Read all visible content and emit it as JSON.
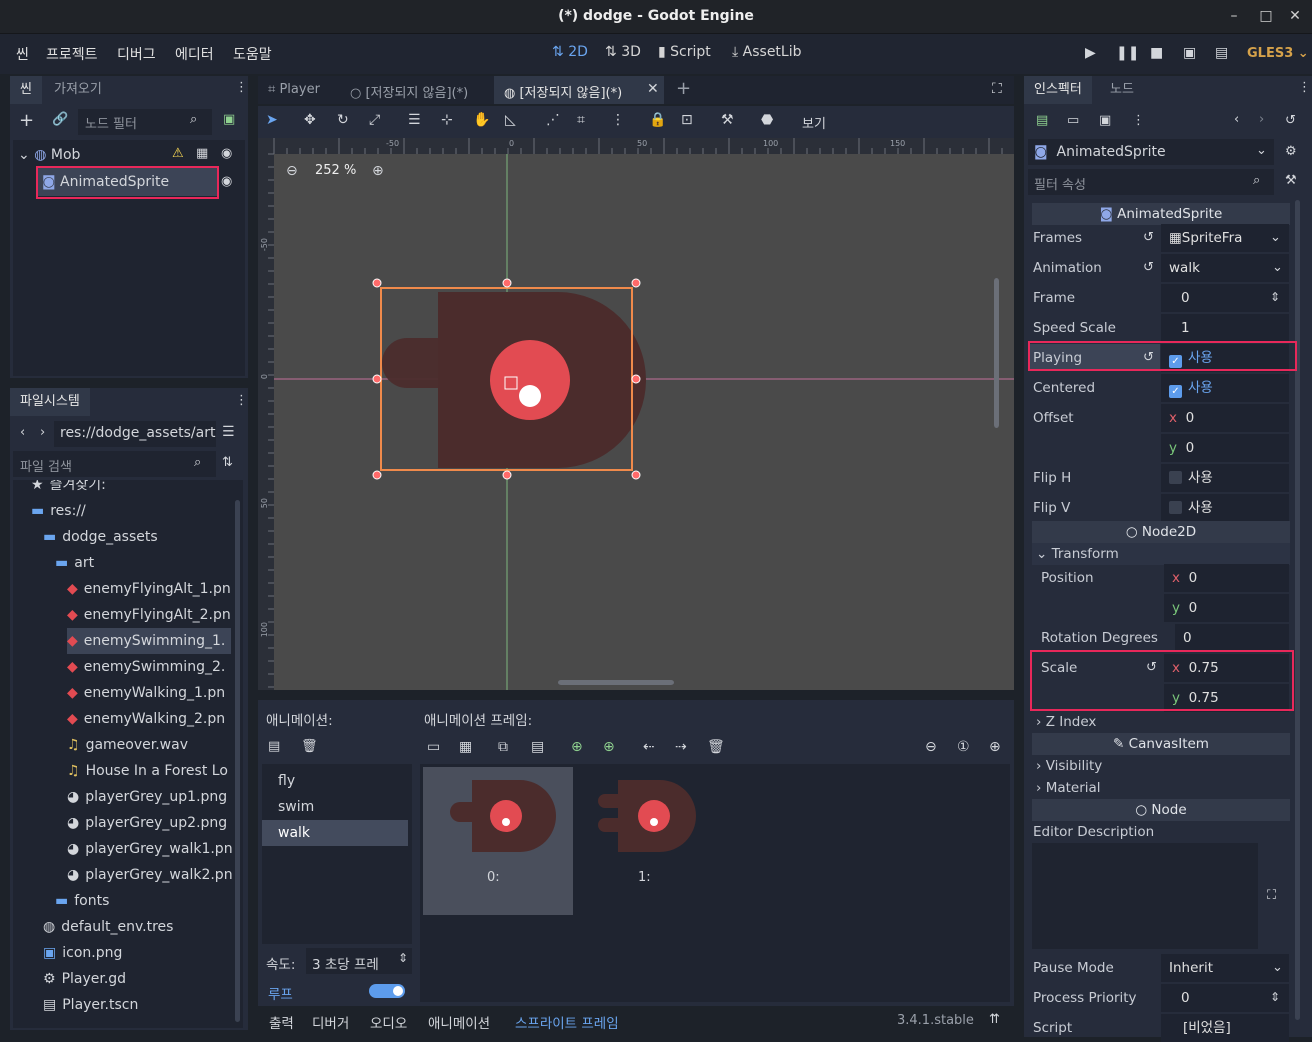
{
  "window": {
    "title": "(*) dodge - Godot Engine",
    "minimize": "–",
    "maximize": "□",
    "close": "✕"
  },
  "menu": {
    "items": [
      "씬",
      "프로젝트",
      "디버그",
      "에디터",
      "도움말"
    ]
  },
  "modes": {
    "m2d": "2D",
    "m3d": "3D",
    "script": "Script",
    "assetlib": "AssetLib",
    "renderer": "GLES3"
  },
  "scene_dock": {
    "tabs": [
      "씬",
      "가져오기"
    ],
    "filter_placeholder": "노드 필터",
    "nodes": [
      {
        "name": "Mob"
      },
      {
        "name": "AnimatedSprite"
      }
    ]
  },
  "fs_dock": {
    "title": "파일시스템",
    "path": "res://dodge_assets/art",
    "search_placeholder": "파일 검색",
    "items": [
      {
        "label": "즐겨찾기:",
        "indent": 0,
        "kind": "star"
      },
      {
        "label": "res://",
        "indent": 0,
        "kind": "folder"
      },
      {
        "label": "dodge_assets",
        "indent": 1,
        "kind": "folder"
      },
      {
        "label": "art",
        "indent": 2,
        "kind": "folder"
      },
      {
        "label": "enemyFlyingAlt_1.pn",
        "indent": 3,
        "kind": "img"
      },
      {
        "label": "enemyFlyingAlt_2.pn",
        "indent": 3,
        "kind": "img"
      },
      {
        "label": "enemySwimming_1.",
        "indent": 3,
        "kind": "img",
        "selected": true
      },
      {
        "label": "enemySwimming_2.",
        "indent": 3,
        "kind": "img"
      },
      {
        "label": "enemyWalking_1.pn",
        "indent": 3,
        "kind": "img"
      },
      {
        "label": "enemyWalking_2.pn",
        "indent": 3,
        "kind": "img"
      },
      {
        "label": "gameover.wav",
        "indent": 3,
        "kind": "audio"
      },
      {
        "label": "House In a Forest Lo",
        "indent": 3,
        "kind": "audio"
      },
      {
        "label": "playerGrey_up1.png",
        "indent": 3,
        "kind": "player"
      },
      {
        "label": "playerGrey_up2.png",
        "indent": 3,
        "kind": "player"
      },
      {
        "label": "playerGrey_walk1.pn",
        "indent": 3,
        "kind": "player"
      },
      {
        "label": "playerGrey_walk2.pn",
        "indent": 3,
        "kind": "player"
      },
      {
        "label": "fonts",
        "indent": 2,
        "kind": "folder"
      },
      {
        "label": "default_env.tres",
        "indent": 1,
        "kind": "globe"
      },
      {
        "label": "icon.png",
        "indent": 1,
        "kind": "icon"
      },
      {
        "label": "Player.gd",
        "indent": 1,
        "kind": "gear"
      },
      {
        "label": "Player.tscn",
        "indent": 1,
        "kind": "clap"
      }
    ]
  },
  "editor_tabs": [
    {
      "label": "Player"
    },
    {
      "label": "[저장되지 않음](*)"
    },
    {
      "label": "[저장되지 않음](*)"
    }
  ],
  "toolbar": {
    "view_label": "보기"
  },
  "viewport": {
    "zoom": "252 %",
    "ruler_top": [
      "-50",
      "0",
      "50",
      "100",
      "150"
    ],
    "ruler_left": [
      "-50",
      "0",
      "50",
      "100"
    ]
  },
  "anim_panel": {
    "animations_title": "애니메이션:",
    "frames_title": "애니메이션 프레임:",
    "animations": [
      "fly",
      "swim",
      "walk"
    ],
    "selected_animation": "walk",
    "frames": [
      "0:",
      "1:"
    ],
    "speed_label": "속도:",
    "speed_value": "3 초당 프레",
    "loop_label": "루프",
    "loop_on": true
  },
  "bottom_tabs": [
    "출력",
    "디버거",
    "오디오",
    "애니메이션",
    "스프라이트 프레임"
  ],
  "version": "3.4.1.stable",
  "inspector": {
    "tabs": [
      "인스펙터",
      "노드"
    ],
    "object": "AnimatedSprite",
    "filter_placeholder": "필터 속성",
    "section_animated": "AnimatedSprite",
    "frames_label": "Frames",
    "frames_value": "SpriteFra",
    "animation_label": "Animation",
    "animation_value": "walk",
    "frame_label": "Frame",
    "frame_value": "0",
    "speed_scale_label": "Speed Scale",
    "speed_scale_value": "1",
    "playing_label": "Playing",
    "playing_value": "사용",
    "centered_label": "Centered",
    "centered_value": "사용",
    "offset_label": "Offset",
    "offset_x": "0",
    "offset_y": "0",
    "fliph_label": "Flip H",
    "fliph_value": "사용",
    "flipv_label": "Flip V",
    "flipv_value": "사용",
    "section_node2d": "Node2D",
    "transform_label": "Transform",
    "position_label": "Position",
    "position_x": "0",
    "position_y": "0",
    "rotation_label": "Rotation Degrees",
    "rotation_value": "0",
    "scale_label": "Scale",
    "scale_x": "0.75",
    "scale_y": "0.75",
    "zindex_label": "Z Index",
    "section_canvas": "CanvasItem",
    "visibility_label": "Visibility",
    "material_label": "Material",
    "section_node": "Node",
    "editor_desc_label": "Editor Description",
    "pause_mode_label": "Pause Mode",
    "pause_mode_value": "Inherit",
    "process_priority_label": "Process Priority",
    "process_priority_value": "0",
    "script_label": "Script",
    "script_value": "[비었음]"
  },
  "colors": {
    "accent": "#5d9cec",
    "highlight": "#e8285a",
    "enemy_body": "#4b2c2c",
    "enemy_eye": "#e24b52",
    "selection_box": "#f08a4b"
  }
}
